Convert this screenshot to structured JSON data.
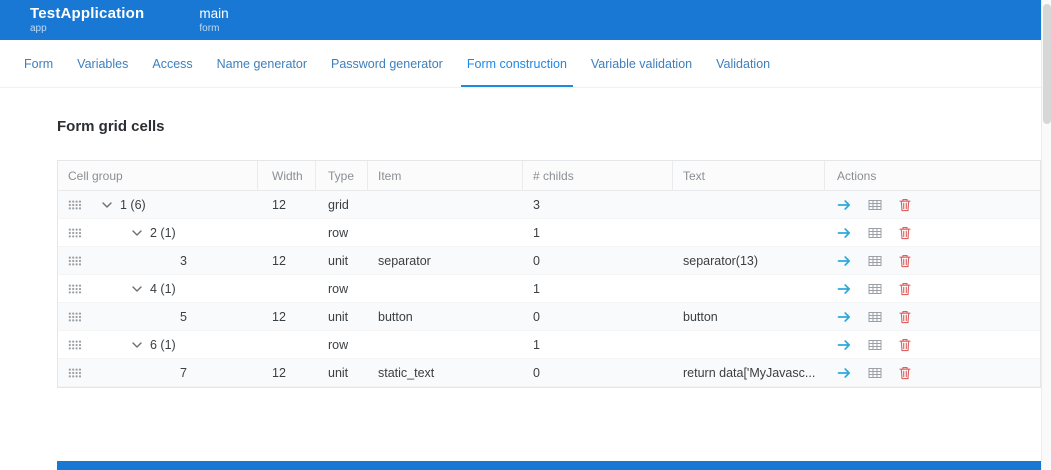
{
  "topbar": {
    "app_title": "TestApplication",
    "app_subtitle": "app",
    "form_title": "main",
    "form_subtitle": "form"
  },
  "tabs": {
    "active_label": "Form construction",
    "items": [
      {
        "label": "Form"
      },
      {
        "label": "Variables"
      },
      {
        "label": "Access"
      },
      {
        "label": "Name generator"
      },
      {
        "label": "Password generator"
      },
      {
        "label": "Form construction"
      },
      {
        "label": "Variable validation"
      },
      {
        "label": "Validation"
      }
    ]
  },
  "page": {
    "heading": "Form grid cells"
  },
  "table": {
    "columns": [
      "Cell group",
      "Width",
      "Type",
      "Item",
      "# childs",
      "Text",
      "Actions"
    ],
    "action_icons": [
      "arrow-right-icon",
      "table-icon",
      "trash-icon"
    ],
    "rows": [
      {
        "num": "1 (6)",
        "width": "12",
        "type": "grid",
        "item": "",
        "childs": "3",
        "text": "",
        "level": 0,
        "expandable": true
      },
      {
        "num": "2 (1)",
        "width": "",
        "type": "row",
        "item": "",
        "childs": "1",
        "text": "",
        "level": 1,
        "expandable": true
      },
      {
        "num": "3",
        "width": "12",
        "type": "unit",
        "item": "separator",
        "childs": "0",
        "text": "separator(13)",
        "level": 2,
        "expandable": false
      },
      {
        "num": "4 (1)",
        "width": "",
        "type": "row",
        "item": "",
        "childs": "1",
        "text": "",
        "level": 1,
        "expandable": true
      },
      {
        "num": "5",
        "width": "12",
        "type": "unit",
        "item": "button",
        "childs": "0",
        "text": "button",
        "level": 2,
        "expandable": false
      },
      {
        "num": "6 (1)",
        "width": "",
        "type": "row",
        "item": "",
        "childs": "1",
        "text": "",
        "level": 1,
        "expandable": true
      },
      {
        "num": "7",
        "width": "12",
        "type": "unit",
        "item": "static_text",
        "childs": "0",
        "text": "return data['MyJavasc...",
        "level": 2,
        "expandable": false
      }
    ]
  },
  "colors": {
    "topbar": "#1878d3",
    "tab_inactive": "#3d7fbe",
    "tab_active": "#1e88e5",
    "arrow": "#2fa8dc",
    "icon_gray": "#9aa0a6",
    "trash": "#e05f5f"
  }
}
